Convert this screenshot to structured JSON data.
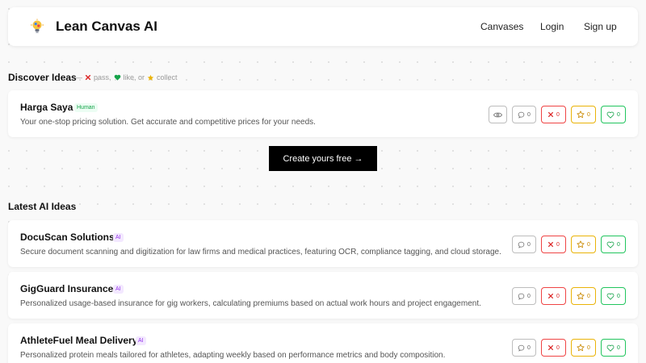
{
  "header": {
    "brand": "Lean Canvas AI",
    "logo_icon": "lightbulb-icon",
    "nav": {
      "canvases": "Canvases",
      "login": "Login",
      "signup": "Sign up"
    }
  },
  "discover": {
    "title": "Discover Ideas",
    "hint": {
      "dash": "—",
      "pass": "pass,",
      "like": "like, or",
      "collect": "collect"
    },
    "card": {
      "title": "Harga Saya",
      "badge": "Human",
      "desc": "Your one-stop pricing solution. Get accurate and competitive prices for your needs.",
      "comments": "0",
      "pass": "0",
      "collect": "0",
      "like": "0"
    }
  },
  "cta": {
    "label": "Create yours free →"
  },
  "latest": {
    "title": "Latest AI Ideas",
    "items": [
      {
        "title": "DocuScan Solutions",
        "badge": "AI",
        "desc": "Secure document scanning and digitization for law firms and medical practices, featuring OCR, compliance tagging, and cloud storage.",
        "comments": "0",
        "pass": "0",
        "collect": "0",
        "like": "0"
      },
      {
        "title": "GigGuard Insurance",
        "badge": "AI",
        "desc": "Personalized usage-based insurance for gig workers, calculating premiums based on actual work hours and project engagement.",
        "comments": "0",
        "pass": "0",
        "collect": "0",
        "like": "0"
      },
      {
        "title": "AthleteFuel Meal Delivery",
        "badge": "AI",
        "desc": "Personalized protein meals tailored for athletes, adapting weekly based on performance metrics and body composition.",
        "comments": "0",
        "pass": "0",
        "collect": "0",
        "like": "0"
      }
    ]
  },
  "colors": {
    "pass": "#dc2626",
    "collect": "#ca8a04",
    "like": "#16a34a",
    "cta_bg": "#000000"
  }
}
